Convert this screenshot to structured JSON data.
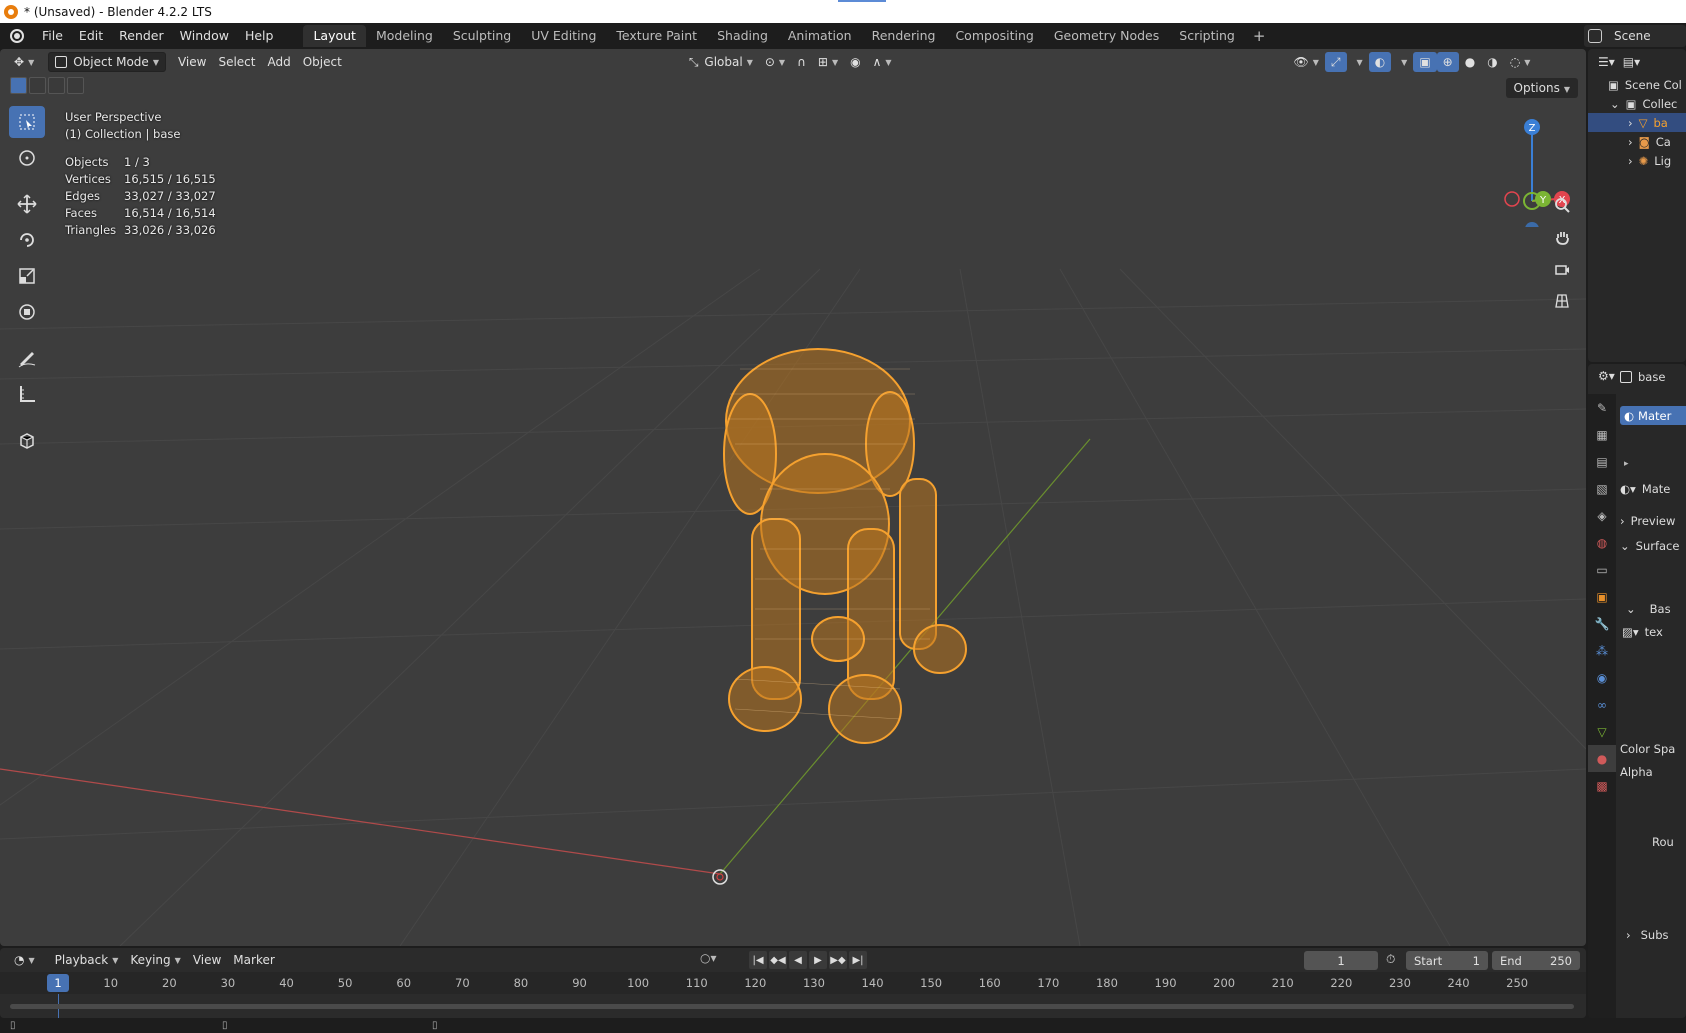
{
  "window": {
    "title": "* (Unsaved) - Blender 4.2.2 LTS"
  },
  "menu": {
    "items": [
      "File",
      "Edit",
      "Render",
      "Window",
      "Help"
    ]
  },
  "workspaces": {
    "tabs": [
      "Layout",
      "Modeling",
      "Sculpting",
      "UV Editing",
      "Texture Paint",
      "Shading",
      "Animation",
      "Rendering",
      "Compositing",
      "Geometry Nodes",
      "Scripting"
    ],
    "active": "Layout",
    "add_symbol": "+"
  },
  "scene": {
    "label": "Scene"
  },
  "viewport_header": {
    "mode": "Object Mode",
    "menus": [
      "View",
      "Select",
      "Add",
      "Object"
    ],
    "transform_orientation": "Global",
    "options_label": "Options"
  },
  "viewport_overlay": {
    "view_name": "User Perspective",
    "collection_line": "(1) Collection | base",
    "stats": [
      {
        "key": "Objects",
        "value": "1 / 3"
      },
      {
        "key": "Vertices",
        "value": "16,515 / 16,515"
      },
      {
        "key": "Edges",
        "value": "33,027 / 33,027"
      },
      {
        "key": "Faces",
        "value": "16,514 / 16,514"
      },
      {
        "key": "Triangles",
        "value": "33,026 / 33,026"
      }
    ]
  },
  "gizmo": {
    "z_label": "Z",
    "y_label": "Y",
    "x_label": "X",
    "colors": {
      "x": "#e2454f",
      "y": "#7bb534",
      "z": "#3a7fd6"
    }
  },
  "outliner": {
    "rows": [
      {
        "label": "Scene Col",
        "icon": "scene-collection-icon"
      },
      {
        "label": "Collec",
        "icon": "collection-icon"
      },
      {
        "label": "ba",
        "icon": "mesh-icon",
        "selected": true
      },
      {
        "label": "Ca",
        "icon": "camera-icon"
      },
      {
        "label": "Lig",
        "icon": "light-icon"
      }
    ]
  },
  "properties": {
    "object_name": "base",
    "material_slot": "Mater",
    "material_name": "Mate",
    "preview_label": "Preview",
    "surface_label": "Surface",
    "base_label": "Bas",
    "texture_label": "tex",
    "color_space_label": "Color Spa",
    "alpha_label": "Alpha",
    "rou_label": "Rou",
    "subs_label": "Subs"
  },
  "timeline": {
    "menus": [
      "Playback",
      "Keying",
      "View",
      "Marker"
    ],
    "current_frame": "1",
    "start_label": "Start",
    "start_value": "1",
    "end_label": "End",
    "end_value": "250",
    "ruler_labels": [
      "10",
      "20",
      "30",
      "40",
      "50",
      "60",
      "70",
      "80",
      "90",
      "100",
      "110",
      "120",
      "130",
      "140",
      "150",
      "160",
      "170",
      "180",
      "190",
      "200",
      "210",
      "220",
      "230",
      "240",
      "250"
    ],
    "playhead_label": "1"
  },
  "colors": {
    "accent": "#4772b3",
    "selection_orange": "#f5a12f",
    "viewport_bg": "#3d3d3d"
  }
}
